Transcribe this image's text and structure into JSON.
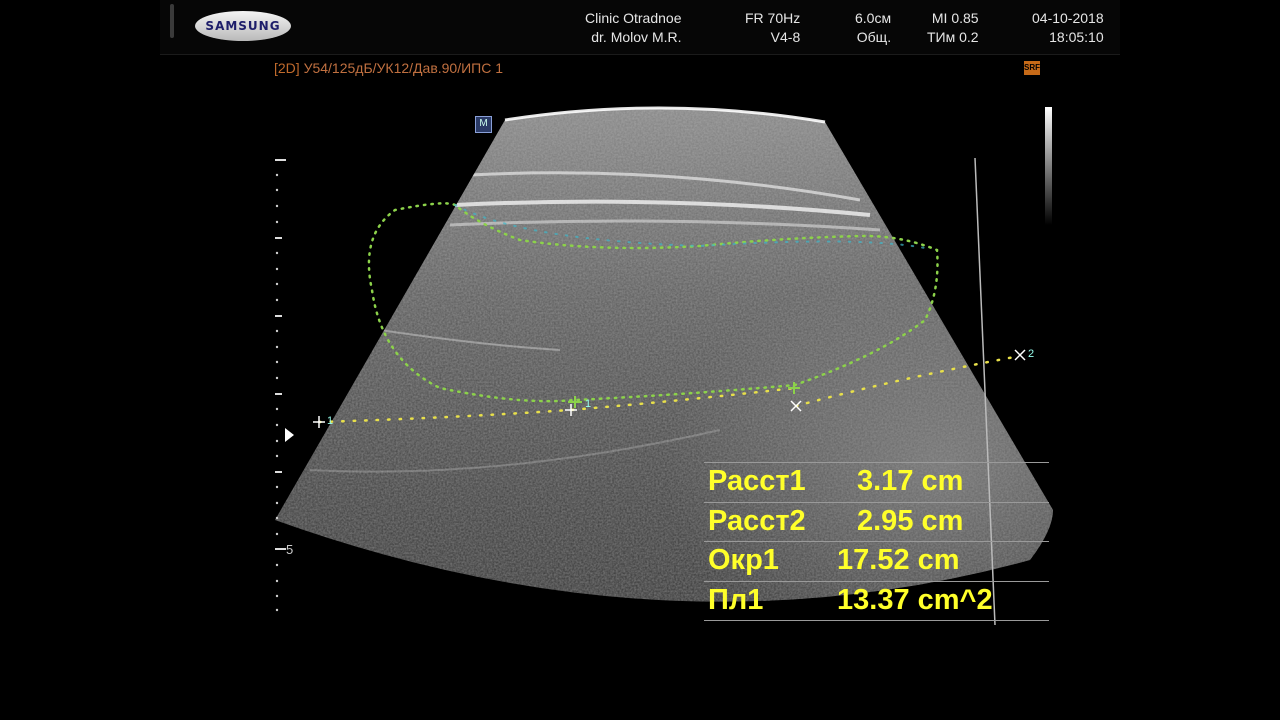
{
  "header": {
    "brand": "SAMSUNG",
    "clinic": "Clinic  Otradnoe",
    "doctor": "dr. Molov M.R.",
    "frame_rate": "FR 70Hz",
    "probe": "V4-8",
    "depth": "6.0см",
    "preset": "Общ.",
    "mi": "MI  0.85",
    "tim": "ТИм 0.2",
    "date": "04-10-2018",
    "time": "18:05:10"
  },
  "imaging": {
    "mode": "[2D]",
    "params": "У54/125дБ/УК12/Дав.90/ИПС 1",
    "srf_badge": "SRF",
    "m_badge": "M",
    "depth_label": "5"
  },
  "caliper_labels": {
    "p1": "1",
    "p2": "2",
    "c1": "1"
  },
  "measurements": [
    {
      "label": "Расст1",
      "value": "3.17 cm"
    },
    {
      "label": "Расст2",
      "value": "2.95 cm"
    },
    {
      "label": "Окр1",
      "value": "17.52 cm"
    },
    {
      "label": "Пл1",
      "value": "13.37 cm^2"
    }
  ],
  "colors": {
    "measure_text": "#ffff2a",
    "trace_dots": "#8cd24a",
    "mode_text": "#c06a2c"
  }
}
